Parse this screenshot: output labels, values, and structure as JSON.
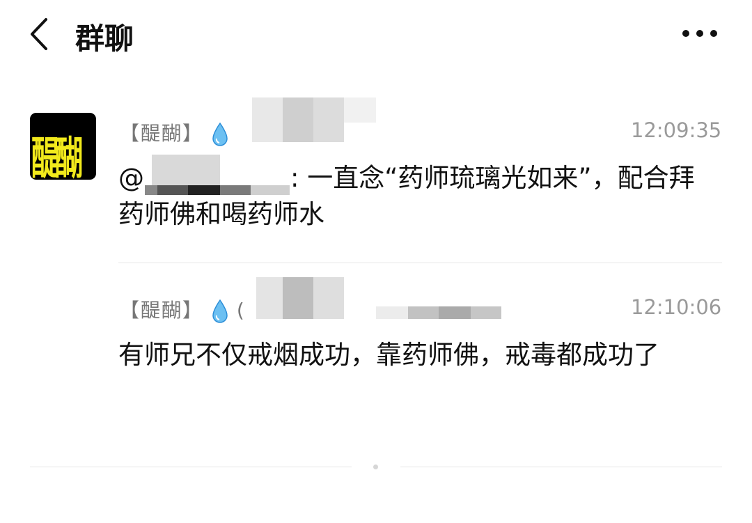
{
  "header": {
    "title": "群聊",
    "back_icon": "back-arrow-icon",
    "more_icon": "more-icon"
  },
  "colors": {
    "avatar_bg": "#000000",
    "avatar_text": "#f2ea1c",
    "drop": "#4aa3e8",
    "muted": "#9a9a9a"
  },
  "messages": [
    {
      "sender": "【醍醐】",
      "paren": "",
      "time": "12:09:35",
      "mention": "@",
      "colon": ":",
      "text": "一直念“药师琉璃光如来”，配合拜药师佛和喝药师水"
    },
    {
      "sender": "【醍醐】",
      "paren": "(",
      "time": "12:10:06",
      "text": "有师兄不仅戒烟成功，靠药师佛，戒毒都成功了"
    }
  ],
  "avatar": {
    "text": "醍醐"
  }
}
